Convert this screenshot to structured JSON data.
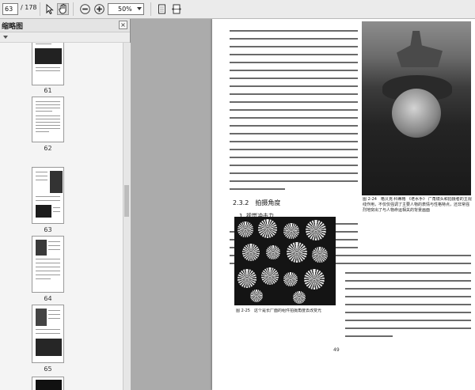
{
  "toolbar": {
    "current_page": "63",
    "total_pages": "/ 178",
    "zoom": "50%"
  },
  "panel": {
    "title": "缩略图",
    "close": "×"
  },
  "thumbnails": [
    {
      "label": "61"
    },
    {
      "label": "62"
    },
    {
      "label": "63"
    },
    {
      "label": "64"
    },
    {
      "label": "65"
    }
  ],
  "document": {
    "section_heading": "2.3.2　拍摄角度",
    "subheading": "1. 视觉冲击力",
    "figure_caption_1": "图 2-24　格贝克·科蒂格 《老水手》 广角镜头和拍摄者的主视线作用，不仅仅强调了主要人物的表情与性格特点，还非常强烈地突出了与人物命运相关的背景画面",
    "figure_caption_2": "图 2-25　这个是长厂面的组件拍摄角度去改变光",
    "page_number": "49"
  },
  "colors": {
    "toolbar_bg": "#ebebeb",
    "panel_bg": "#f4f4f4",
    "viewer_bg": "#ababab",
    "page_bg": "#ffffff"
  }
}
